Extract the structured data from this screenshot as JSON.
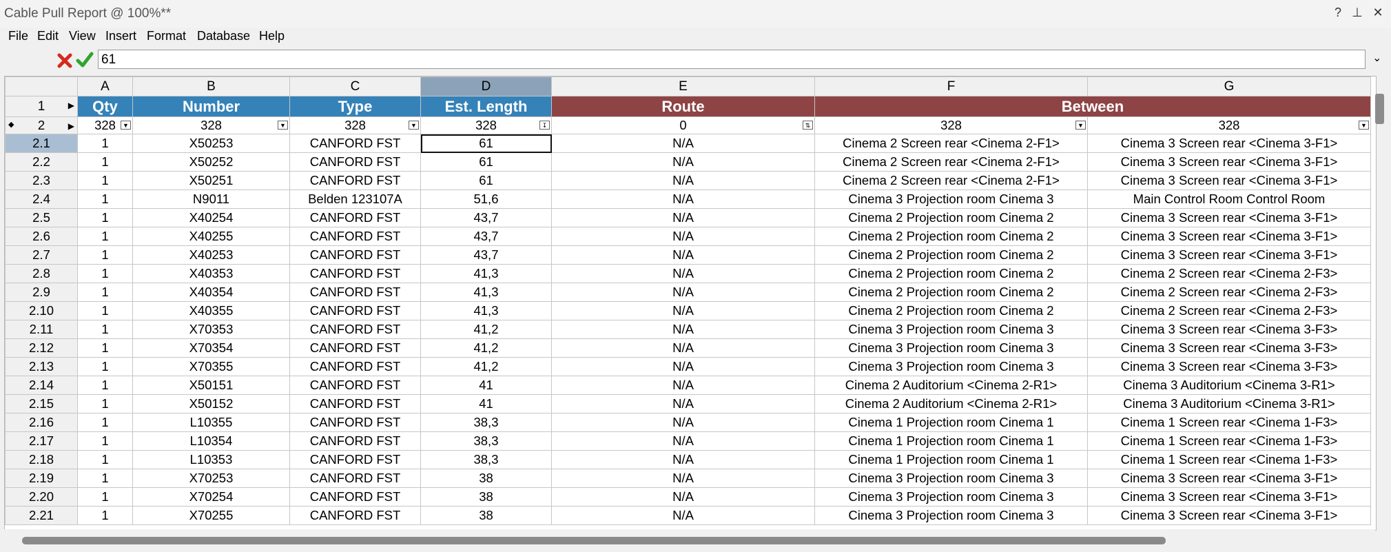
{
  "window": {
    "title": "Cable Pull Report @ 100%**",
    "help": "?",
    "pin": "⊥",
    "close": "✕"
  },
  "menu": [
    "File",
    "Edit",
    "View",
    "Insert",
    "Format",
    "Database",
    "Help"
  ],
  "formula": {
    "value": "61",
    "cancel_icon": "red-x-icon",
    "accept_icon": "green-check-icon",
    "dropdown": "⌄"
  },
  "columns": [
    "A",
    "B",
    "C",
    "D",
    "E",
    "F",
    "G"
  ],
  "header_row": {
    "row_label": "1",
    "cells": [
      "Qty",
      "Number",
      "Type",
      "Est. Length",
      "Route",
      "Between"
    ]
  },
  "filter_row": {
    "row_label": "2",
    "cells": [
      "328",
      "328",
      "328",
      "328",
      "0",
      "328",
      "328"
    ]
  },
  "rows": [
    [
      "2.1",
      "1",
      "X50253",
      "CANFORD FST",
      "61",
      "N/A",
      "Cinema 2 Screen rear <Cinema 2-F1>",
      "Cinema 3 Screen rear <Cinema 3-F1>"
    ],
    [
      "2.2",
      "1",
      "X50252",
      "CANFORD FST",
      "61",
      "N/A",
      "Cinema 2 Screen rear <Cinema 2-F1>",
      "Cinema 3 Screen rear <Cinema 3-F1>"
    ],
    [
      "2.3",
      "1",
      "X50251",
      "CANFORD FST",
      "61",
      "N/A",
      "Cinema 2 Screen rear <Cinema 2-F1>",
      "Cinema 3 Screen rear <Cinema 3-F1>"
    ],
    [
      "2.4",
      "1",
      "N9011",
      "Belden 123107A",
      "51,6",
      "N/A",
      "Cinema 3 Projection room Cinema 3",
      "Main Control Room Control Room"
    ],
    [
      "2.5",
      "1",
      "X40254",
      "CANFORD FST",
      "43,7",
      "N/A",
      "Cinema 2 Projection room Cinema 2",
      "Cinema 3 Screen rear <Cinema 3-F1>"
    ],
    [
      "2.6",
      "1",
      "X40255",
      "CANFORD FST",
      "43,7",
      "N/A",
      "Cinema 2 Projection room Cinema 2",
      "Cinema 3 Screen rear <Cinema 3-F1>"
    ],
    [
      "2.7",
      "1",
      "X40253",
      "CANFORD FST",
      "43,7",
      "N/A",
      "Cinema 2 Projection room Cinema 2",
      "Cinema 3 Screen rear <Cinema 3-F1>"
    ],
    [
      "2.8",
      "1",
      "X40353",
      "CANFORD FST",
      "41,3",
      "N/A",
      "Cinema 2 Projection room Cinema 2",
      "Cinema 2 Screen rear <Cinema 2-F3>"
    ],
    [
      "2.9",
      "1",
      "X40354",
      "CANFORD FST",
      "41,3",
      "N/A",
      "Cinema 2 Projection room Cinema 2",
      "Cinema 2 Screen rear <Cinema 2-F3>"
    ],
    [
      "2.10",
      "1",
      "X40355",
      "CANFORD FST",
      "41,3",
      "N/A",
      "Cinema 2 Projection room Cinema 2",
      "Cinema 2 Screen rear <Cinema 2-F3>"
    ],
    [
      "2.11",
      "1",
      "X70353",
      "CANFORD FST",
      "41,2",
      "N/A",
      "Cinema 3 Projection room Cinema 3",
      "Cinema 3 Screen rear <Cinema 3-F3>"
    ],
    [
      "2.12",
      "1",
      "X70354",
      "CANFORD FST",
      "41,2",
      "N/A",
      "Cinema 3 Projection room Cinema 3",
      "Cinema 3 Screen rear <Cinema 3-F3>"
    ],
    [
      "2.13",
      "1",
      "X70355",
      "CANFORD FST",
      "41,2",
      "N/A",
      "Cinema 3 Projection room Cinema 3",
      "Cinema 3 Screen rear <Cinema 3-F3>"
    ],
    [
      "2.14",
      "1",
      "X50151",
      "CANFORD FST",
      "41",
      "N/A",
      "Cinema 2 Auditorium <Cinema 2-R1>",
      "Cinema 3 Auditorium <Cinema 3-R1>"
    ],
    [
      "2.15",
      "1",
      "X50152",
      "CANFORD FST",
      "41",
      "N/A",
      "Cinema 2 Auditorium <Cinema 2-R1>",
      "Cinema 3 Auditorium <Cinema 3-R1>"
    ],
    [
      "2.16",
      "1",
      "L10355",
      "CANFORD FST",
      "38,3",
      "N/A",
      "Cinema 1 Projection room Cinema 1",
      "Cinema 1 Screen rear <Cinema 1-F3>"
    ],
    [
      "2.17",
      "1",
      "L10354",
      "CANFORD FST",
      "38,3",
      "N/A",
      "Cinema 1 Projection room Cinema 1",
      "Cinema 1 Screen rear <Cinema 1-F3>"
    ],
    [
      "2.18",
      "1",
      "L10353",
      "CANFORD FST",
      "38,3",
      "N/A",
      "Cinema 1 Projection room Cinema 1",
      "Cinema 1 Screen rear <Cinema 1-F3>"
    ],
    [
      "2.19",
      "1",
      "X70253",
      "CANFORD FST",
      "38",
      "N/A",
      "Cinema 3 Projection room Cinema 3",
      "Cinema 3 Screen rear <Cinema 3-F1>"
    ],
    [
      "2.20",
      "1",
      "X70254",
      "CANFORD FST",
      "38",
      "N/A",
      "Cinema 3 Projection room Cinema 3",
      "Cinema 3 Screen rear <Cinema 3-F1>"
    ],
    [
      "2.21",
      "1",
      "X70255",
      "CANFORD FST",
      "38",
      "N/A",
      "Cinema 3 Projection room Cinema 3",
      "Cinema 3 Screen rear <Cinema 3-F1>"
    ]
  ],
  "colors": {
    "header_blue": "#3582b9",
    "header_red": "#8e4445",
    "selected_col": "#8aa3b9"
  }
}
